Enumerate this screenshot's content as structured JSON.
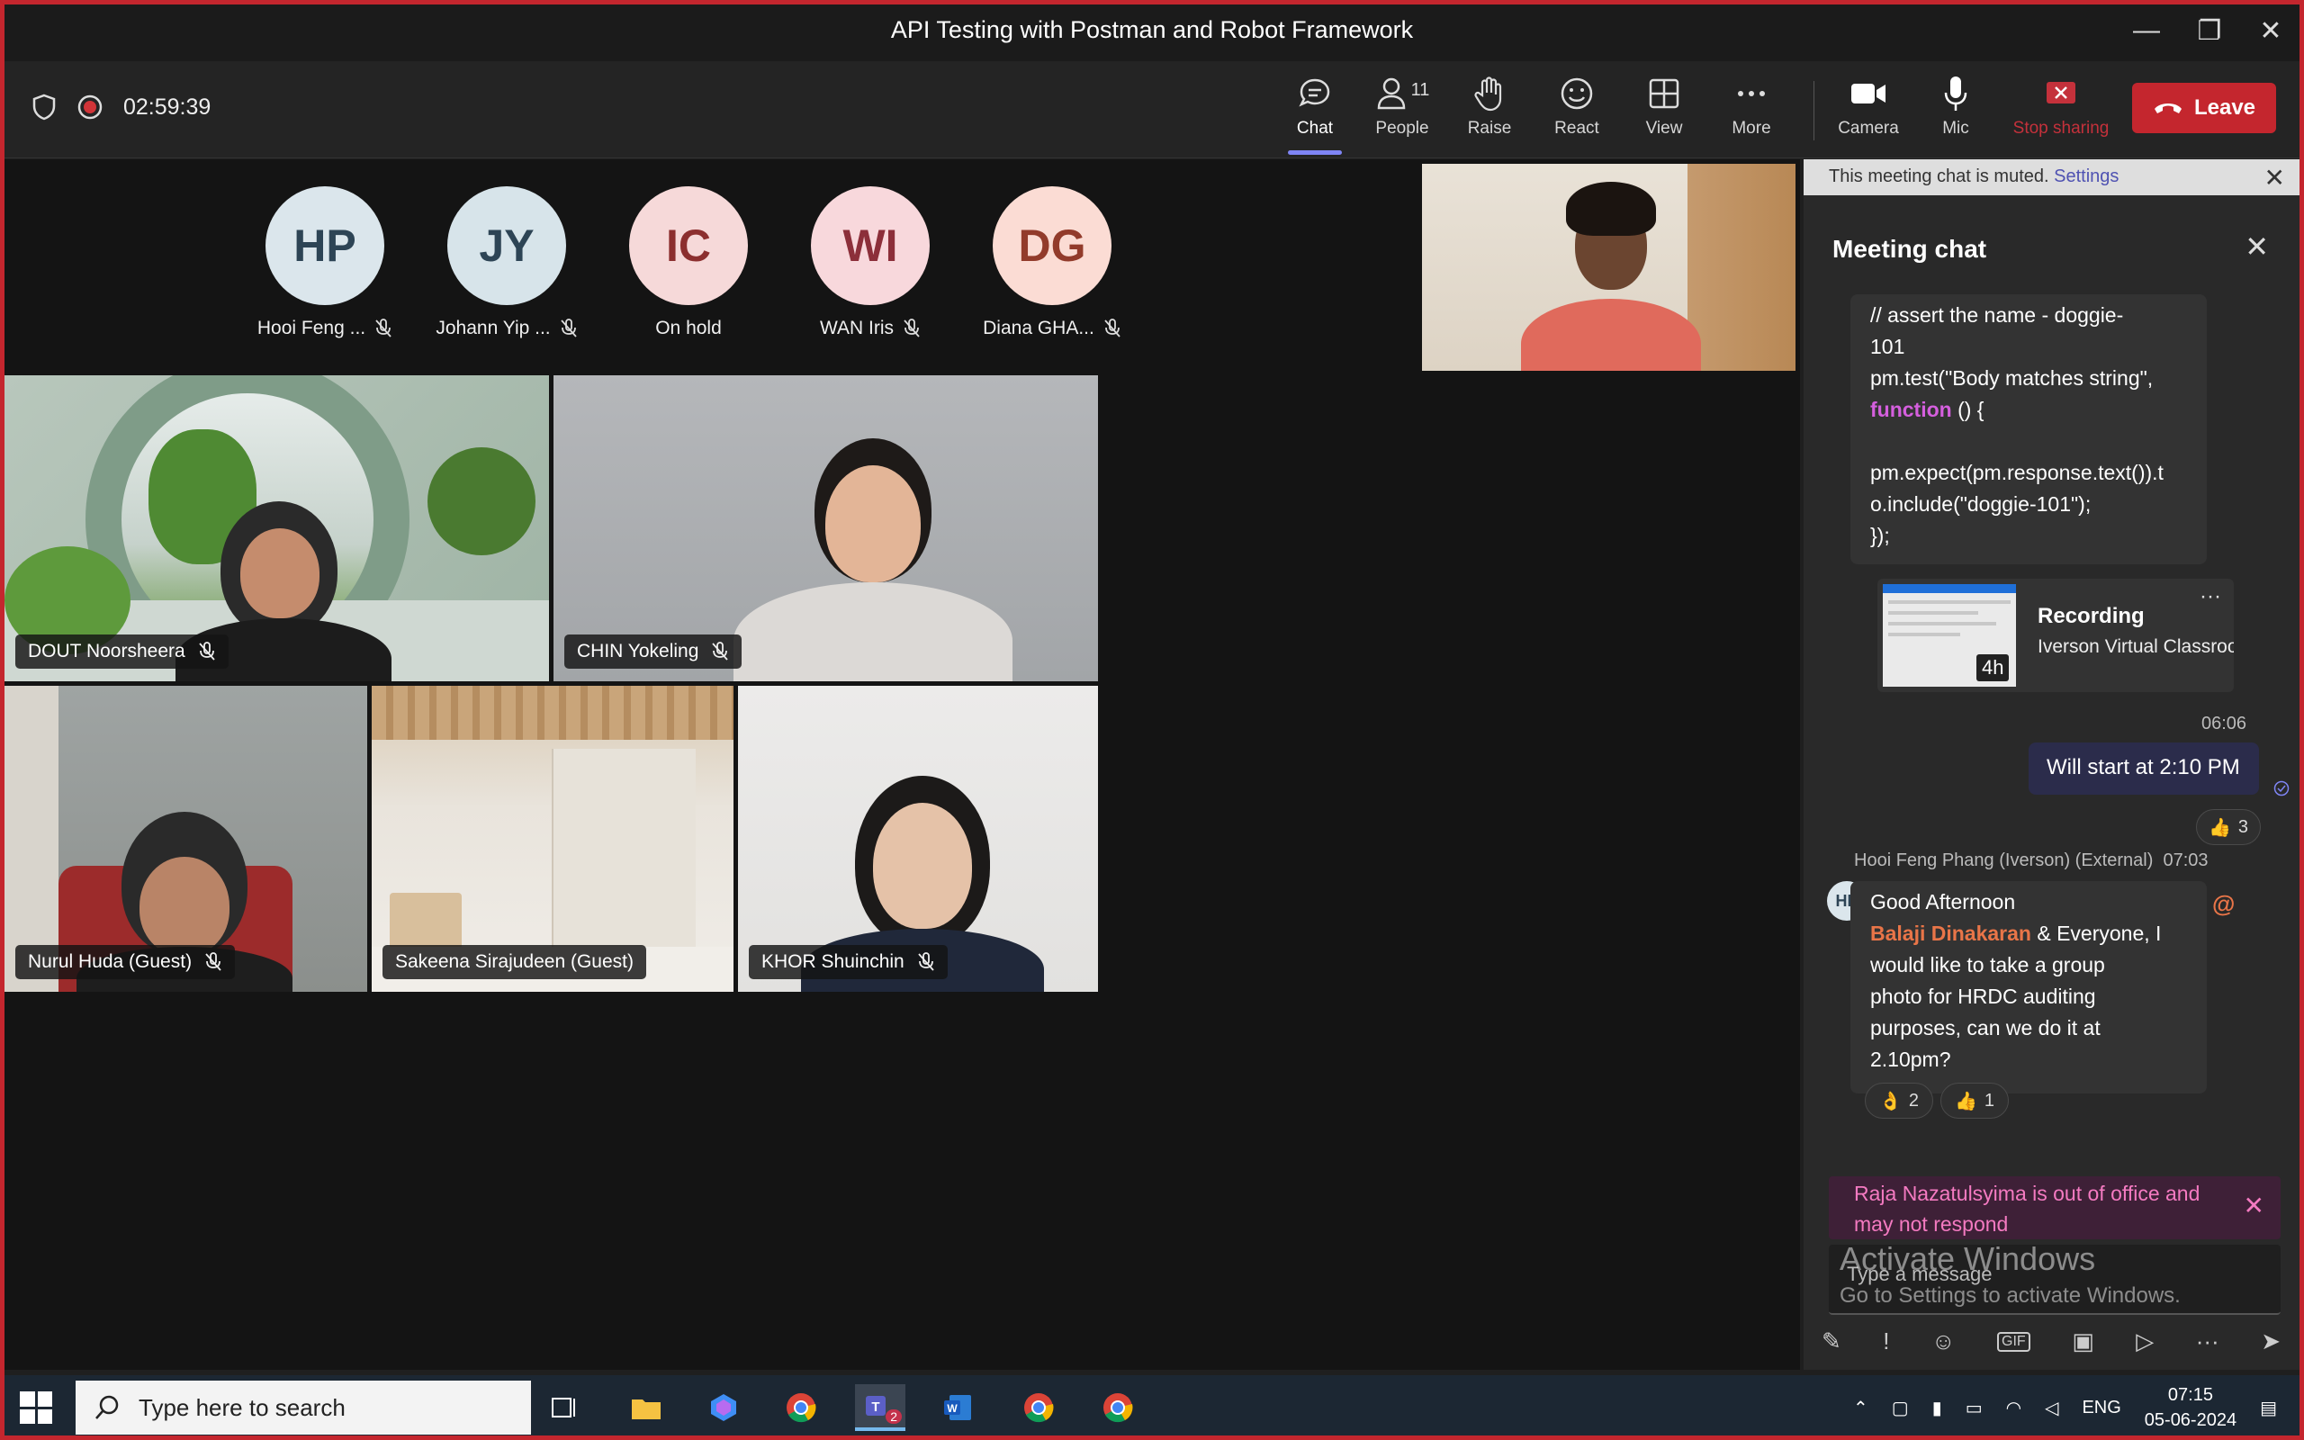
{
  "window": {
    "title": "API Testing with Postman and Robot Framework",
    "minimize": "—",
    "restore": "❐",
    "close": "✕"
  },
  "toolbar": {
    "timer": "02:59:39",
    "buttons": {
      "chat": "Chat",
      "people": "People",
      "people_count": "11",
      "raise": "Raise",
      "react": "React",
      "view": "View",
      "more": "More",
      "camera": "Camera",
      "mic": "Mic",
      "stop_sharing": "Stop sharing"
    },
    "leave": "Leave"
  },
  "participants_strip": [
    {
      "initials": "HP",
      "name": "Hooi Feng ...",
      "muted": true,
      "bg": "#dbe6ec",
      "fg": "#2d4455"
    },
    {
      "initials": "JY",
      "name": "Johann Yip ...",
      "muted": true,
      "bg": "#d7e4ea",
      "fg": "#2d4455"
    },
    {
      "initials": "IC",
      "name": "On hold",
      "muted": false,
      "bg": "#f6d9d9",
      "fg": "#8c2f2f"
    },
    {
      "initials": "WI",
      "name": "WAN Iris",
      "muted": true,
      "bg": "#f8d8dc",
      "fg": "#8c2f3a"
    },
    {
      "initials": "DG",
      "name": "Diana GHA...",
      "muted": true,
      "bg": "#fbdcd4",
      "fg": "#923b2b"
    }
  ],
  "tiles": {
    "t1": "DOUT Noorsheera",
    "t2": "CHIN Yokeling",
    "t3": "Nurul Huda (Guest)",
    "t4": "Sakeena Sirajudeen (Guest)",
    "t5": "KHOR Shuinchin"
  },
  "chat": {
    "muted_notice": "This meeting chat is muted.",
    "settings_link": "Settings",
    "title": "Meeting chat",
    "code": {
      "l1": "// assert the name - doggie-",
      "l2": "101",
      "l3": "pm.test(\"Body matches string\",",
      "l4_kw": "function",
      "l4_rest": " () {",
      "l5": "",
      "l6": "pm.expect(pm.response.text()).t",
      "l7": "o.include(\"doggie-101\");",
      "l8": "});"
    },
    "recording": {
      "title": "Recording",
      "subtitle": "Iverson Virtual Classroo...",
      "duration": "4h"
    },
    "my_msg_time": "06:06",
    "my_msg": "Will start at 2:10 PM",
    "my_msg_reaction_count": "3",
    "hp_sender": "Hooi Feng Phang (Iverson) (External)",
    "hp_time": "07:03",
    "hp_initials": "HP",
    "hp_line1": "Good Afternoon",
    "hp_mention": "Balaji Dinakaran",
    "hp_line2": " & Everyone, I",
    "hp_line3": "would like to take a group",
    "hp_line4": "photo for HRDC auditing",
    "hp_line5": "purposes, can we do it at",
    "hp_line6": "2.10pm?",
    "hp_reaction1_count": "2",
    "hp_reaction2_count": "1",
    "ooo_text": "Raja Nazatulsyima is out of office and may not respond",
    "compose_placeholder": "Type a message"
  },
  "watermark": {
    "line1": "Activate Windows",
    "line2": "Go to Settings to activate Windows."
  },
  "taskbar": {
    "search_placeholder": "Type here to search",
    "teams_badge": "2",
    "lang": "ENG",
    "time": "07:15",
    "date": "05-06-2024"
  },
  "colors": {
    "accent": "#7f85f5",
    "leave": "#c4262e",
    "mention": "#e97548",
    "ooo_text": "#f47ac1"
  }
}
